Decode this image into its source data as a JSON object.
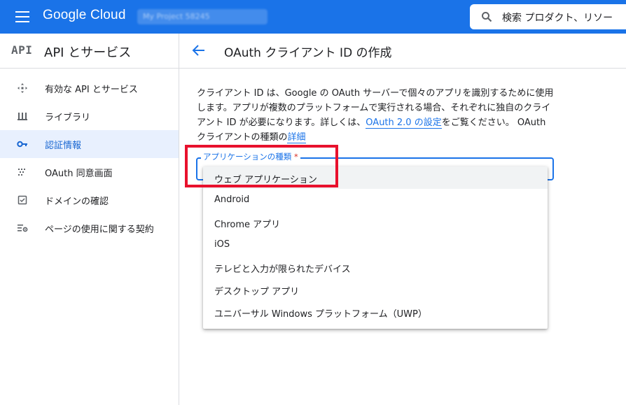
{
  "topbar": {
    "brand": "Google Cloud",
    "project": "My Project 58245",
    "search_placeholder": "検索  プロダクト、リソー"
  },
  "sidebar": {
    "api_logo": "API",
    "title": "API とサービス",
    "items": [
      {
        "label": "有効な API とサービス",
        "icon": "apis-icon"
      },
      {
        "label": "ライブラリ",
        "icon": "library-icon"
      },
      {
        "label": "認証情報",
        "icon": "key-icon",
        "active": true
      },
      {
        "label": "OAuth 同意画面",
        "icon": "consent-icon"
      },
      {
        "label": "ドメインの確認",
        "icon": "domain-check-icon"
      },
      {
        "label": "ページの使用に関する契約",
        "icon": "settings-list-icon"
      }
    ]
  },
  "page": {
    "title": "OAuth クライアント ID の作成",
    "desc_1": "クライアント ID は、Google の OAuth サーバーで個々のアプリを識別するために使用します。アプリが複数のプラットフォームで実行される場合、それぞれに独自のクライアント ID が必要になります。詳しくは、",
    "desc_link_1": "OAuth 2.0 の設定",
    "desc_2": "をご覧ください。 OAuth クライアントの種類の",
    "desc_link_2": "詳細"
  },
  "select": {
    "label": "アプリケーションの種類",
    "required_mark": "*",
    "options": [
      "ウェブ アプリケーション",
      "Android",
      "Chrome アプリ",
      "iOS",
      "テレビと入力が限られたデバイス",
      "デスクトップ アプリ",
      "ユニバーサル Windows プラットフォーム（UWP）"
    ]
  },
  "colors": {
    "primary": "#1a73e8",
    "highlight": "#e8112d"
  }
}
